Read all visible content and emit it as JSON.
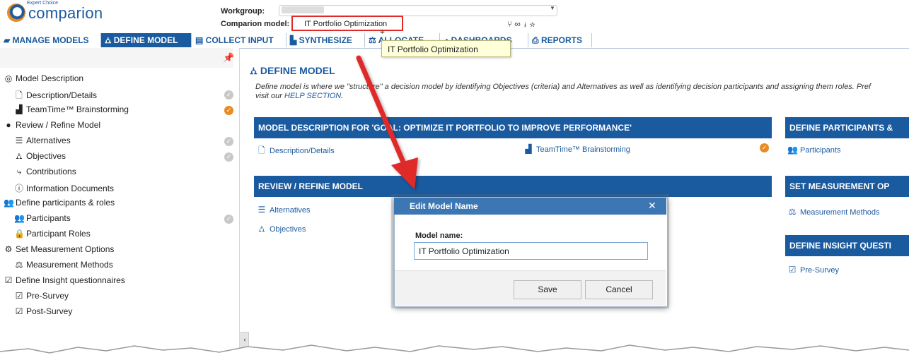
{
  "brand": {
    "small": "Expert Choice",
    "name": "comparion",
    "accent": "#1a5a9e",
    "orange": "#e98a23"
  },
  "header": {
    "workgroup_label": "Workgroup:",
    "model_label": "Comparion model:",
    "model_value": "IT Portfolio Optimization",
    "icons": [
      "tree-icon",
      "link-icon",
      "download-icon",
      "star-icon"
    ]
  },
  "nav": {
    "items": [
      {
        "label": "MANAGE MODELS",
        "icon": "folder-icon"
      },
      {
        "label": "DEFINE MODEL",
        "icon": "hierarchy-icon",
        "active": true
      },
      {
        "label": "COLLECT INPUT",
        "icon": "keyboard-icon"
      },
      {
        "label": "SYNTHESIZE",
        "icon": "chart-icon"
      },
      {
        "label": "ALLOCATE",
        "icon": "scale-icon"
      },
      {
        "label": "DASHBOARDS",
        "icon": "gauge-icon"
      },
      {
        "label": "REPORTS",
        "icon": "print-icon"
      }
    ],
    "tooltip": "IT Portfolio Optimization"
  },
  "sidebar": {
    "items": [
      {
        "label": "Model Description",
        "icon": "target-icon"
      },
      {
        "label": "Description/Details",
        "icon": "document-icon"
      },
      {
        "label": "TeamTime™ Brainstorming",
        "icon": "teamtime-icon"
      },
      {
        "label": "Review / Refine Model",
        "icon": "circle-icon"
      },
      {
        "label": "Alternatives",
        "icon": "list-icon"
      },
      {
        "label": "Objectives",
        "icon": "hierarchy-icon"
      },
      {
        "label": "Contributions",
        "icon": "contributions-icon"
      },
      {
        "label": "Information Documents",
        "icon": "info-icon"
      },
      {
        "label": "Define participants & roles",
        "icon": "users-icon"
      },
      {
        "label": "Participants",
        "icon": "users-icon"
      },
      {
        "label": "Participant Roles",
        "icon": "lock-icon"
      },
      {
        "label": "Set Measurement Options",
        "icon": "gears-icon"
      },
      {
        "label": "Measurement Methods",
        "icon": "scale-icon"
      },
      {
        "label": "Define Insight questionnaires",
        "icon": "survey-icon"
      },
      {
        "label": "Pre-Survey",
        "icon": "survey-icon"
      },
      {
        "label": "Post-Survey",
        "icon": "survey-icon"
      }
    ]
  },
  "main": {
    "title": "DEFINE MODEL",
    "description": "Define model is where we \"structure\" a decision model by identifying Objectives (criteria) and Alternatives as well as identifying decision participants and assigning them roles. Pref",
    "description_2": "visit our ",
    "help_link": "HELP SECTION",
    "help_suffix": ".",
    "panels": {
      "model_desc": "MODEL DESCRIPTION FOR 'GOAL: OPTIMIZE IT PORTFOLIO TO IMPROVE PERFORMANCE'",
      "participants": "DEFINE PARTICIPANTS &",
      "review": "REVIEW / REFINE MODEL",
      "measurement": "SET MEASUREMENT OP",
      "insight": "DEFINE INSIGHT QUESTI"
    },
    "links": {
      "description_details": "Description/Details",
      "teamtime": "TeamTime™ Brainstorming",
      "participants": "Participants",
      "alternatives": "Alternatives",
      "objectives": "Objectives",
      "measurement_methods": "Measurement Methods",
      "pre_survey": "Pre-Survey"
    }
  },
  "modal": {
    "title": "Edit Model Name",
    "label": "Model name:",
    "value": "IT Portfolio Optimization",
    "save": "Save",
    "cancel": "Cancel"
  }
}
